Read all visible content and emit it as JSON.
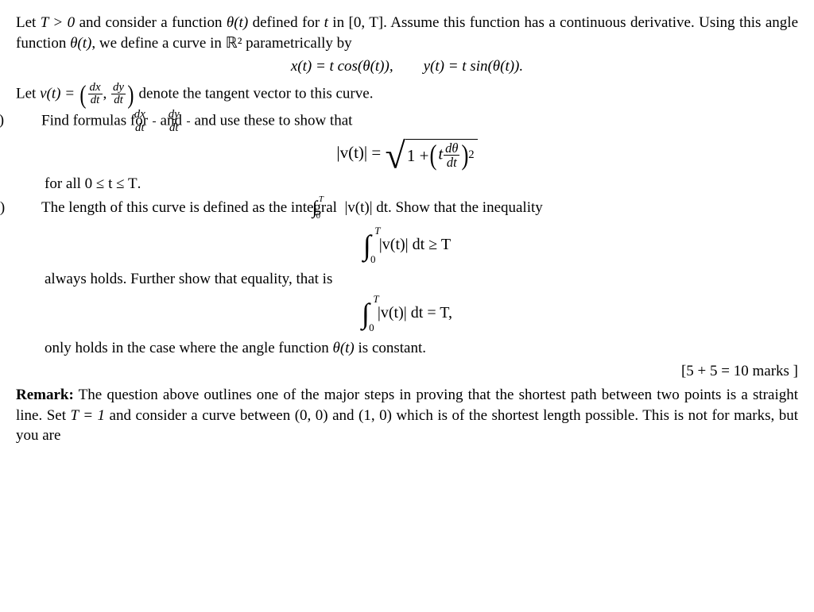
{
  "intro": {
    "line1_pre": "Let ",
    "t_gt_0": "T > 0",
    "line1_mid": " and consider a function ",
    "theta_t": "θ(t)",
    "line1_mid2": " defined for ",
    "t_var": "t",
    "line1_mid3": " in ",
    "interval": "[0, T]",
    "line1_post": ". Assume this function has a continuous derivative. Using this angle function ",
    "theta_t2": "θ(t)",
    "line1_post2": ", we define a curve in ",
    "r2": "ℝ²",
    "line1_end": " parametrically by"
  },
  "xy_def": {
    "x_eq": "x(t)  =  t cos(θ(t)),",
    "gap": "        ",
    "y_eq": "y(t)  =  t sin(θ(t))."
  },
  "v_def": {
    "pre": "Let ",
    "v_eq": "v(t) = ",
    "dx_num": "dx",
    "dt_den": "dt",
    "dy_num": "dy",
    "post": " denote the tangent vector to this curve."
  },
  "part_a": {
    "label": "(a)",
    "pre": "Find formulas for ",
    "and": " and ",
    "post": " and use these to show that"
  },
  "norm_v": {
    "lhs": "|v(t)| = ",
    "one_plus": "1 + ",
    "t_var": "t",
    "dtheta": "dθ",
    "dt": "dt",
    "sq": "2"
  },
  "forall": {
    "pre": "for all ",
    "range": "0 ≤ t ≤ T",
    "post": "."
  },
  "part_b": {
    "label": "(b)",
    "pre": "The length of this curve is defined as the integral ",
    "T": "T",
    "zero": "0",
    "integrand": " |v(t)| dt",
    "post": ". Show that the inequality"
  },
  "ineq": {
    "integrand": "|v(t)| dt ≥ T",
    "T": "T",
    "zero": "0"
  },
  "always": "always holds. Further show that equality, that is",
  "eq": {
    "integrand": "|v(t)| dt = T,",
    "T": "T",
    "zero": "0"
  },
  "only_holds": {
    "pre": "only holds in the case where the angle function ",
    "theta": "θ(t)",
    "post": " is constant."
  },
  "marks": "[5 + 5 = 10 marks ]",
  "remark": {
    "label": "Remark:",
    "body_pre": "   The question above outlines one of the major steps in proving that the shortest path between two points is a straight line. Set ",
    "t1": "T = 1",
    "body_mid": " and consider a curve between ",
    "p00": "(0, 0)",
    "body_mid2": " and ",
    "p10": "(1, 0)",
    "body_post": " which is of the shortest length possible. This is not for marks, but you are"
  }
}
